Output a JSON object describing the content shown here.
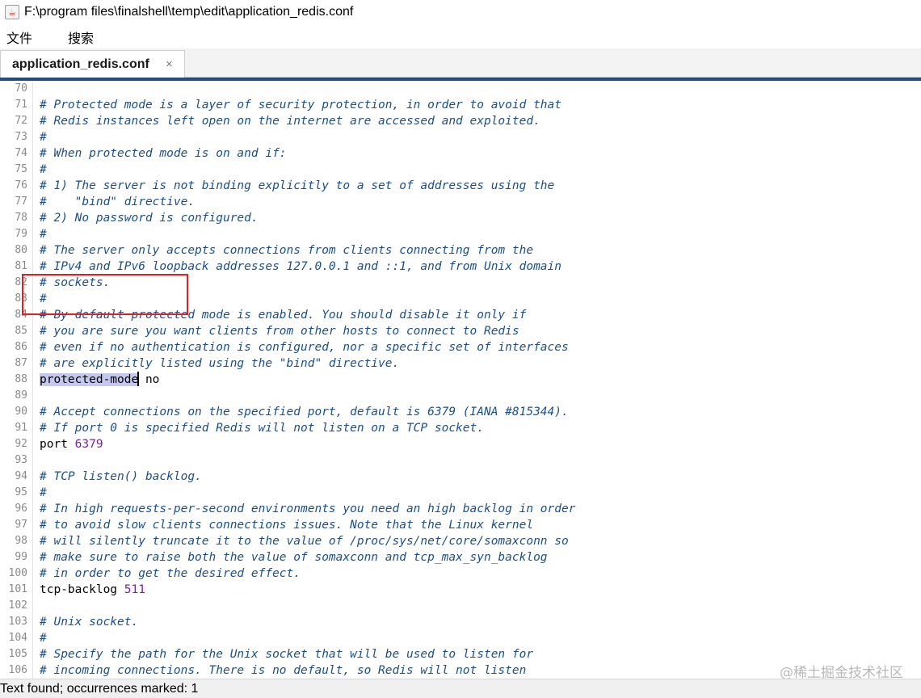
{
  "window": {
    "title": "F:\\program files\\finalshell\\temp\\edit\\application_redis.conf"
  },
  "menu": {
    "items": [
      "文件",
      "搜索"
    ]
  },
  "tab": {
    "label": "application_redis.conf",
    "close": "×"
  },
  "editor": {
    "lines": [
      {
        "n": "70",
        "text": ""
      },
      {
        "n": "71",
        "text": "# Protected mode is a layer of security protection, in order to avoid that"
      },
      {
        "n": "72",
        "text": "# Redis instances left open on the internet are accessed and exploited."
      },
      {
        "n": "73",
        "text": "#"
      },
      {
        "n": "74",
        "text": "# When protected mode is on and if:"
      },
      {
        "n": "75",
        "text": "#"
      },
      {
        "n": "76",
        "text": "# 1) The server is not binding explicitly to a set of addresses using the"
      },
      {
        "n": "77",
        "text": "#    \"bind\" directive."
      },
      {
        "n": "78",
        "text": "# 2) No password is configured."
      },
      {
        "n": "79",
        "text": "#"
      },
      {
        "n": "80",
        "text": "# The server only accepts connections from clients connecting from the"
      },
      {
        "n": "81",
        "text": "# IPv4 and IPv6 loopback addresses 127.0.0.1 and ::1, and from Unix domain"
      },
      {
        "n": "82",
        "text": "# sockets."
      },
      {
        "n": "83",
        "text": "#"
      },
      {
        "n": "84",
        "text": "# By default protected mode is enabled. You should disable it only if"
      },
      {
        "n": "85",
        "text": "# you are sure you want clients from other hosts to connect to Redis"
      },
      {
        "n": "86",
        "text": "# even if no authentication is configured, nor a specific set of interfaces"
      },
      {
        "n": "87",
        "text": "# are explicitly listed using the \"bind\" directive."
      },
      {
        "n": "88",
        "key": "protected-mode",
        "value": " no"
      },
      {
        "n": "89",
        "text": ""
      },
      {
        "n": "90",
        "text": "# Accept connections on the specified port, default is 6379 (IANA #815344)."
      },
      {
        "n": "91",
        "text": "# If port 0 is specified Redis will not listen on a TCP socket."
      },
      {
        "n": "92",
        "key": "port",
        "num": "6379"
      },
      {
        "n": "93",
        "text": ""
      },
      {
        "n": "94",
        "text": "# TCP listen() backlog."
      },
      {
        "n": "95",
        "text": "#"
      },
      {
        "n": "96",
        "text": "# In high requests-per-second environments you need an high backlog in order"
      },
      {
        "n": "97",
        "text": "# to avoid slow clients connections issues. Note that the Linux kernel"
      },
      {
        "n": "98",
        "text": "# will silently truncate it to the value of /proc/sys/net/core/somaxconn so"
      },
      {
        "n": "99",
        "text": "# make sure to raise both the value of somaxconn and tcp_max_syn_backlog"
      },
      {
        "n": "100",
        "text": "# in order to get the desired effect."
      },
      {
        "n": "101",
        "key": "tcp-backlog",
        "num": "511"
      },
      {
        "n": "102",
        "text": ""
      },
      {
        "n": "103",
        "text": "# Unix socket."
      },
      {
        "n": "104",
        "text": "#"
      },
      {
        "n": "105",
        "text": "# Specify the path for the Unix socket that will be used to listen for"
      },
      {
        "n": "106",
        "text": "# incoming connections. There is no default, so Redis will not listen"
      }
    ]
  },
  "status": {
    "text": "Text found; occurrences marked: 1"
  },
  "watermark": {
    "text": "@稀土掘金技术社区"
  }
}
